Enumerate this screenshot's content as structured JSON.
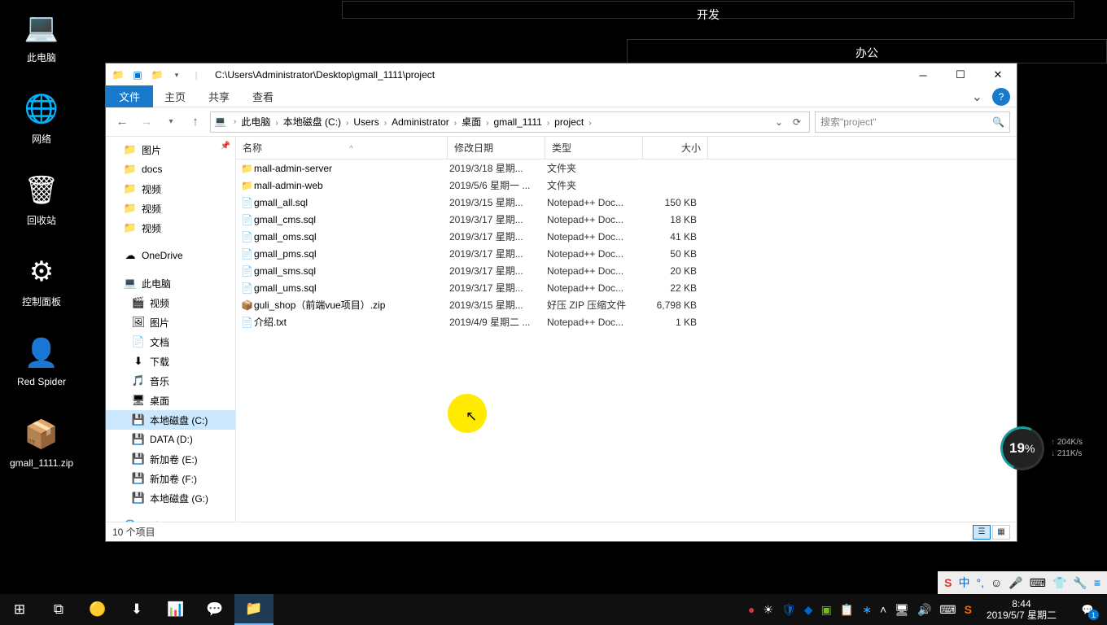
{
  "desktop_icons": [
    {
      "label": "此电脑",
      "glyph": "💻"
    },
    {
      "label": "网络",
      "glyph": "🌐"
    },
    {
      "label": "回收站",
      "glyph": "🗑"
    },
    {
      "label": "控制面板",
      "glyph": "⚙"
    },
    {
      "label": "Red Spider",
      "glyph": "👤"
    },
    {
      "label": "gmall_1111.zip",
      "glyph": "📦"
    }
  ],
  "overlay_tabs": {
    "dev": "开发",
    "office": "办公"
  },
  "window": {
    "title": "C:\\Users\\Administrator\\Desktop\\gmall_1111\\project",
    "ribbon": {
      "file": "文件",
      "home": "主页",
      "share": "共享",
      "view": "查看"
    },
    "breadcrumbs": [
      "此电脑",
      "本地磁盘 (C:)",
      "Users",
      "Administrator",
      "桌面",
      "gmall_1111",
      "project"
    ],
    "search_placeholder": "搜索\"project\"",
    "columns": {
      "name": "名称",
      "date": "修改日期",
      "type": "类型",
      "size": "大小"
    },
    "nav": {
      "quick": [
        {
          "label": "图片",
          "icon": "folder"
        },
        {
          "label": "docs",
          "icon": "folder"
        },
        {
          "label": "视频",
          "icon": "folder"
        },
        {
          "label": "视频",
          "icon": "folder"
        },
        {
          "label": "视频",
          "icon": "folder"
        }
      ],
      "onedrive": "OneDrive",
      "thispc_label": "此电脑",
      "thispc": [
        {
          "label": "视频",
          "icon": "video"
        },
        {
          "label": "图片",
          "icon": "pic"
        },
        {
          "label": "文档",
          "icon": "doc"
        },
        {
          "label": "下载",
          "icon": "dl"
        },
        {
          "label": "音乐",
          "icon": "music"
        },
        {
          "label": "桌面",
          "icon": "desk"
        },
        {
          "label": "本地磁盘 (C:)",
          "icon": "drive",
          "selected": true
        },
        {
          "label": "DATA (D:)",
          "icon": "drive"
        },
        {
          "label": "新加卷 (E:)",
          "icon": "drive"
        },
        {
          "label": "新加卷 (F:)",
          "icon": "drive"
        },
        {
          "label": "本地磁盘 (G:)",
          "icon": "drive"
        }
      ],
      "network": "网络"
    },
    "files": [
      {
        "name": "mall-admin-server",
        "date": "2019/3/18 星期...",
        "type": "文件夹",
        "size": "",
        "icon": "folder"
      },
      {
        "name": "mall-admin-web",
        "date": "2019/5/6 星期一 ...",
        "type": "文件夹",
        "size": "",
        "icon": "folder"
      },
      {
        "name": "gmall_all.sql",
        "date": "2019/3/15 星期...",
        "type": "Notepad++ Doc...",
        "size": "150 KB",
        "icon": "sql"
      },
      {
        "name": "gmall_cms.sql",
        "date": "2019/3/17 星期...",
        "type": "Notepad++ Doc...",
        "size": "18 KB",
        "icon": "sql"
      },
      {
        "name": "gmall_oms.sql",
        "date": "2019/3/17 星期...",
        "type": "Notepad++ Doc...",
        "size": "41 KB",
        "icon": "sql"
      },
      {
        "name": "gmall_pms.sql",
        "date": "2019/3/17 星期...",
        "type": "Notepad++ Doc...",
        "size": "50 KB",
        "icon": "sql"
      },
      {
        "name": "gmall_sms.sql",
        "date": "2019/3/17 星期...",
        "type": "Notepad++ Doc...",
        "size": "20 KB",
        "icon": "sql"
      },
      {
        "name": "gmall_ums.sql",
        "date": "2019/3/17 星期...",
        "type": "Notepad++ Doc...",
        "size": "22 KB",
        "icon": "sql"
      },
      {
        "name": "guli_shop（前端vue项目）.zip",
        "date": "2019/3/15 星期...",
        "type": "好压 ZIP 压缩文件",
        "size": "6,798 KB",
        "icon": "zip"
      },
      {
        "name": "介绍.txt",
        "date": "2019/4/9 星期二 ...",
        "type": "Notepad++ Doc...",
        "size": "1 KB",
        "icon": "txt"
      }
    ],
    "status": "10 个项目"
  },
  "perf": {
    "cpu": "19",
    "cpu_suffix": "%",
    "up": "204",
    "dn": "211",
    "unit": "K/s"
  },
  "ime": {
    "lang": "中",
    "punct": "°,"
  },
  "clock": {
    "time": "8:44",
    "date": "2019/5/7 星期二"
  },
  "notif_count": "1"
}
